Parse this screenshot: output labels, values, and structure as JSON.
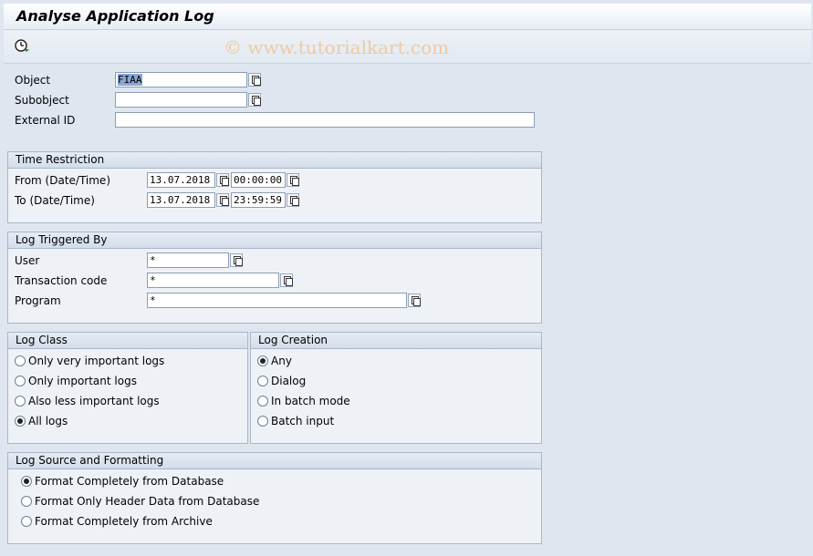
{
  "window": {
    "title": "Analyse Application Log",
    "watermark": "© www.tutorialkart.com"
  },
  "toolbar": {
    "execute_icon": "execute-clock-icon"
  },
  "header_fields": {
    "object": {
      "label": "Object",
      "value": "FIAA"
    },
    "subobject": {
      "label": "Subobject",
      "value": ""
    },
    "external_id": {
      "label": "External ID",
      "value": ""
    }
  },
  "time_restriction": {
    "title": "Time Restriction",
    "from": {
      "label": "From (Date/Time)",
      "date": "13.07.2018",
      "time": "00:00:00"
    },
    "to": {
      "label": "To (Date/Time)",
      "date": "13.07.2018",
      "time": "23:59:59"
    }
  },
  "triggered_by": {
    "title": "Log Triggered By",
    "user": {
      "label": "User",
      "value": "*"
    },
    "transaction": {
      "label": "Transaction code",
      "value": "*"
    },
    "program": {
      "label": "Program",
      "value": "*"
    }
  },
  "log_class": {
    "title": "Log Class",
    "options": [
      "Only very important logs",
      "Only important logs",
      "Also less important logs",
      "All logs"
    ],
    "selected": "All logs"
  },
  "log_creation": {
    "title": "Log Creation",
    "options": [
      "Any",
      "Dialog",
      "In batch mode",
      "Batch input"
    ],
    "selected": "Any"
  },
  "log_source": {
    "title": "Log Source and Formatting",
    "options": [
      "Format Completely from Database",
      "Format Only Header Data from Database",
      "Format Completely from Archive"
    ],
    "selected": "Format Completely from Database"
  }
}
